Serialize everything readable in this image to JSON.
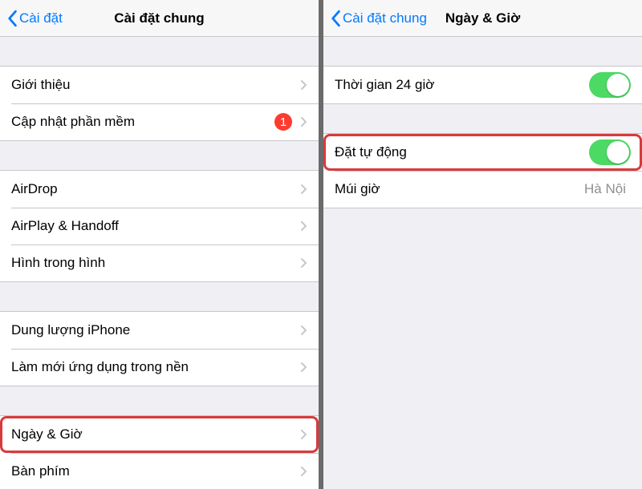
{
  "left": {
    "nav": {
      "back": "Cài đặt",
      "title": "Cài đặt chung"
    },
    "group1": [
      {
        "label": "Giới thiệu",
        "badge": null
      },
      {
        "label": "Cập nhật phần mềm",
        "badge": "1"
      }
    ],
    "group2": [
      {
        "label": "AirDrop"
      },
      {
        "label": "AirPlay & Handoff"
      },
      {
        "label": "Hình trong hình"
      }
    ],
    "group3": [
      {
        "label": "Dung lượng iPhone"
      },
      {
        "label": "Làm mới ứng dụng trong nền"
      }
    ],
    "group4": [
      {
        "label": "Ngày & Giờ",
        "highlight": true
      },
      {
        "label": "Bàn phím"
      }
    ]
  },
  "right": {
    "nav": {
      "back": "Cài đặt chung",
      "title": "Ngày & Giờ"
    },
    "group1": [
      {
        "label": "Thời gian 24 giờ",
        "toggle": true
      }
    ],
    "group2": [
      {
        "label": "Đặt tự động",
        "toggle": true,
        "highlight": true
      },
      {
        "label": "Múi giờ",
        "value": "Hà Nội"
      }
    ]
  }
}
